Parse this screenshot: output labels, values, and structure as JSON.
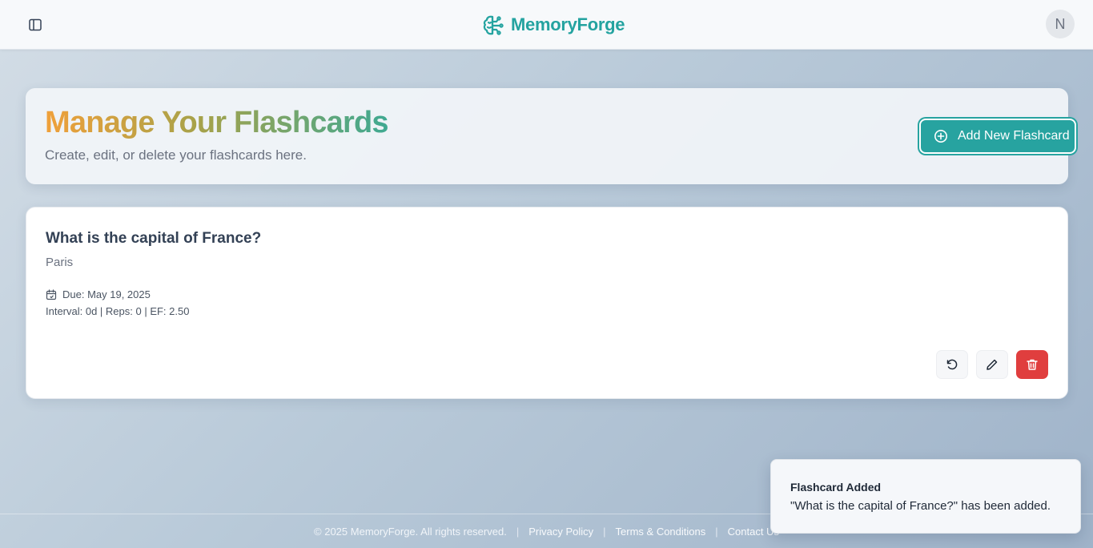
{
  "header": {
    "brand": "MemoryForge",
    "brand_icon": "brain-icon",
    "avatar_initial": "N",
    "accent_color": "#24a3a0"
  },
  "hero": {
    "title": "Manage Your Flashcards",
    "subtitle": "Create, edit, or delete your flashcards here.",
    "add_button_label": "Add New Flashcard"
  },
  "cards": [
    {
      "question": "What is the capital of France?",
      "answer": "Paris",
      "due": "Due: May 19, 2025",
      "stats": "Interval: 0d | Reps: 0 | EF: 2.50"
    }
  ],
  "footer": {
    "copyright": "© 2025 MemoryForge. All rights reserved.",
    "privacy": "Privacy Policy",
    "terms": "Terms & Conditions",
    "contact": "Contact Us",
    "separator": "|"
  },
  "toast": {
    "title": "Flashcard Added",
    "body": "\"What is the capital of France?\" has been added."
  },
  "colors": {
    "danger": "#e03e3e",
    "title_gradient": [
      "#f0a03a",
      "#a6a24a",
      "#3fa992"
    ]
  }
}
